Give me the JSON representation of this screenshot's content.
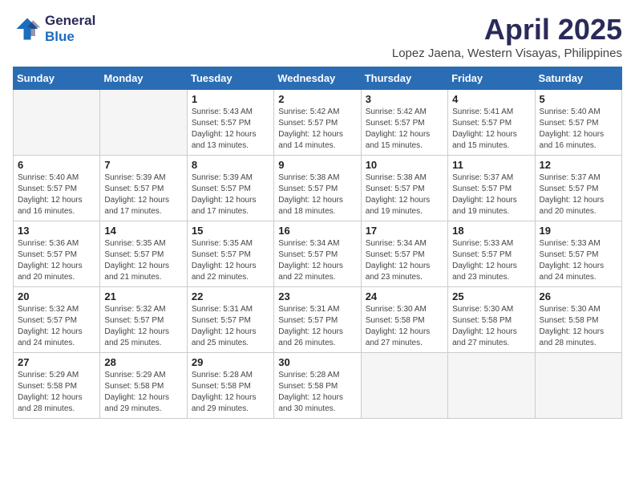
{
  "logo": {
    "line1": "General",
    "line2": "Blue"
  },
  "title": "April 2025",
  "subtitle": "Lopez Jaena, Western Visayas, Philippines",
  "weekdays": [
    "Sunday",
    "Monday",
    "Tuesday",
    "Wednesday",
    "Thursday",
    "Friday",
    "Saturday"
  ],
  "weeks": [
    [
      {
        "day": "",
        "sunrise": "",
        "sunset": "",
        "daylight": ""
      },
      {
        "day": "",
        "sunrise": "",
        "sunset": "",
        "daylight": ""
      },
      {
        "day": "1",
        "sunrise": "Sunrise: 5:43 AM",
        "sunset": "Sunset: 5:57 PM",
        "daylight": "Daylight: 12 hours and 13 minutes."
      },
      {
        "day": "2",
        "sunrise": "Sunrise: 5:42 AM",
        "sunset": "Sunset: 5:57 PM",
        "daylight": "Daylight: 12 hours and 14 minutes."
      },
      {
        "day": "3",
        "sunrise": "Sunrise: 5:42 AM",
        "sunset": "Sunset: 5:57 PM",
        "daylight": "Daylight: 12 hours and 15 minutes."
      },
      {
        "day": "4",
        "sunrise": "Sunrise: 5:41 AM",
        "sunset": "Sunset: 5:57 PM",
        "daylight": "Daylight: 12 hours and 15 minutes."
      },
      {
        "day": "5",
        "sunrise": "Sunrise: 5:40 AM",
        "sunset": "Sunset: 5:57 PM",
        "daylight": "Daylight: 12 hours and 16 minutes."
      }
    ],
    [
      {
        "day": "6",
        "sunrise": "Sunrise: 5:40 AM",
        "sunset": "Sunset: 5:57 PM",
        "daylight": "Daylight: 12 hours and 16 minutes."
      },
      {
        "day": "7",
        "sunrise": "Sunrise: 5:39 AM",
        "sunset": "Sunset: 5:57 PM",
        "daylight": "Daylight: 12 hours and 17 minutes."
      },
      {
        "day": "8",
        "sunrise": "Sunrise: 5:39 AM",
        "sunset": "Sunset: 5:57 PM",
        "daylight": "Daylight: 12 hours and 17 minutes."
      },
      {
        "day": "9",
        "sunrise": "Sunrise: 5:38 AM",
        "sunset": "Sunset: 5:57 PM",
        "daylight": "Daylight: 12 hours and 18 minutes."
      },
      {
        "day": "10",
        "sunrise": "Sunrise: 5:38 AM",
        "sunset": "Sunset: 5:57 PM",
        "daylight": "Daylight: 12 hours and 19 minutes."
      },
      {
        "day": "11",
        "sunrise": "Sunrise: 5:37 AM",
        "sunset": "Sunset: 5:57 PM",
        "daylight": "Daylight: 12 hours and 19 minutes."
      },
      {
        "day": "12",
        "sunrise": "Sunrise: 5:37 AM",
        "sunset": "Sunset: 5:57 PM",
        "daylight": "Daylight: 12 hours and 20 minutes."
      }
    ],
    [
      {
        "day": "13",
        "sunrise": "Sunrise: 5:36 AM",
        "sunset": "Sunset: 5:57 PM",
        "daylight": "Daylight: 12 hours and 20 minutes."
      },
      {
        "day": "14",
        "sunrise": "Sunrise: 5:35 AM",
        "sunset": "Sunset: 5:57 PM",
        "daylight": "Daylight: 12 hours and 21 minutes."
      },
      {
        "day": "15",
        "sunrise": "Sunrise: 5:35 AM",
        "sunset": "Sunset: 5:57 PM",
        "daylight": "Daylight: 12 hours and 22 minutes."
      },
      {
        "day": "16",
        "sunrise": "Sunrise: 5:34 AM",
        "sunset": "Sunset: 5:57 PM",
        "daylight": "Daylight: 12 hours and 22 minutes."
      },
      {
        "day": "17",
        "sunrise": "Sunrise: 5:34 AM",
        "sunset": "Sunset: 5:57 PM",
        "daylight": "Daylight: 12 hours and 23 minutes."
      },
      {
        "day": "18",
        "sunrise": "Sunrise: 5:33 AM",
        "sunset": "Sunset: 5:57 PM",
        "daylight": "Daylight: 12 hours and 23 minutes."
      },
      {
        "day": "19",
        "sunrise": "Sunrise: 5:33 AM",
        "sunset": "Sunset: 5:57 PM",
        "daylight": "Daylight: 12 hours and 24 minutes."
      }
    ],
    [
      {
        "day": "20",
        "sunrise": "Sunrise: 5:32 AM",
        "sunset": "Sunset: 5:57 PM",
        "daylight": "Daylight: 12 hours and 24 minutes."
      },
      {
        "day": "21",
        "sunrise": "Sunrise: 5:32 AM",
        "sunset": "Sunset: 5:57 PM",
        "daylight": "Daylight: 12 hours and 25 minutes."
      },
      {
        "day": "22",
        "sunrise": "Sunrise: 5:31 AM",
        "sunset": "Sunset: 5:57 PM",
        "daylight": "Daylight: 12 hours and 25 minutes."
      },
      {
        "day": "23",
        "sunrise": "Sunrise: 5:31 AM",
        "sunset": "Sunset: 5:57 PM",
        "daylight": "Daylight: 12 hours and 26 minutes."
      },
      {
        "day": "24",
        "sunrise": "Sunrise: 5:30 AM",
        "sunset": "Sunset: 5:58 PM",
        "daylight": "Daylight: 12 hours and 27 minutes."
      },
      {
        "day": "25",
        "sunrise": "Sunrise: 5:30 AM",
        "sunset": "Sunset: 5:58 PM",
        "daylight": "Daylight: 12 hours and 27 minutes."
      },
      {
        "day": "26",
        "sunrise": "Sunrise: 5:30 AM",
        "sunset": "Sunset: 5:58 PM",
        "daylight": "Daylight: 12 hours and 28 minutes."
      }
    ],
    [
      {
        "day": "27",
        "sunrise": "Sunrise: 5:29 AM",
        "sunset": "Sunset: 5:58 PM",
        "daylight": "Daylight: 12 hours and 28 minutes."
      },
      {
        "day": "28",
        "sunrise": "Sunrise: 5:29 AM",
        "sunset": "Sunset: 5:58 PM",
        "daylight": "Daylight: 12 hours and 29 minutes."
      },
      {
        "day": "29",
        "sunrise": "Sunrise: 5:28 AM",
        "sunset": "Sunset: 5:58 PM",
        "daylight": "Daylight: 12 hours and 29 minutes."
      },
      {
        "day": "30",
        "sunrise": "Sunrise: 5:28 AM",
        "sunset": "Sunset: 5:58 PM",
        "daylight": "Daylight: 12 hours and 30 minutes."
      },
      {
        "day": "",
        "sunrise": "",
        "sunset": "",
        "daylight": ""
      },
      {
        "day": "",
        "sunrise": "",
        "sunset": "",
        "daylight": ""
      },
      {
        "day": "",
        "sunrise": "",
        "sunset": "",
        "daylight": ""
      }
    ]
  ]
}
